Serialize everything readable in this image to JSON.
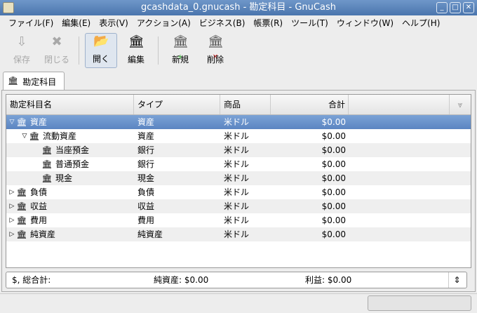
{
  "window": {
    "title": "gcashdata_0.gnucash - 勘定科目 - GnuCash"
  },
  "menu": [
    "ファイル(F)",
    "編集(E)",
    "表示(V)",
    "アクション(A)",
    "ビジネス(B)",
    "帳票(R)",
    "ツール(T)",
    "ウィンドウ(W)",
    "ヘルプ(H)"
  ],
  "toolbar": {
    "save": "保存",
    "close": "閉じる",
    "open": "開く",
    "edit": "編集",
    "new": "新規",
    "delete": "削除"
  },
  "tab": {
    "label": "勘定科目"
  },
  "columns": {
    "name": "勘定科目名",
    "type": "タイプ",
    "commodity": "商品",
    "total": "合計"
  },
  "accounts": [
    {
      "name": "資産",
      "type": "資産",
      "commodity": "米ドル",
      "total": "$0.00",
      "level": 0,
      "expander": "expanded",
      "selected": true
    },
    {
      "name": "流動資産",
      "type": "資産",
      "commodity": "米ドル",
      "total": "$0.00",
      "level": 1,
      "expander": "expanded"
    },
    {
      "name": "当座預金",
      "type": "銀行",
      "commodity": "米ドル",
      "total": "$0.00",
      "level": 2,
      "expander": "none"
    },
    {
      "name": "普通預金",
      "type": "銀行",
      "commodity": "米ドル",
      "total": "$0.00",
      "level": 2,
      "expander": "none"
    },
    {
      "name": "現金",
      "type": "現金",
      "commodity": "米ドル",
      "total": "$0.00",
      "level": 2,
      "expander": "none"
    },
    {
      "name": "負債",
      "type": "負債",
      "commodity": "米ドル",
      "total": "$0.00",
      "level": 0,
      "expander": "collapsed"
    },
    {
      "name": "収益",
      "type": "収益",
      "commodity": "米ドル",
      "total": "$0.00",
      "level": 0,
      "expander": "collapsed"
    },
    {
      "name": "費用",
      "type": "費用",
      "commodity": "米ドル",
      "total": "$0.00",
      "level": 0,
      "expander": "collapsed"
    },
    {
      "name": "純資産",
      "type": "純資産",
      "commodity": "米ドル",
      "total": "$0.00",
      "level": 0,
      "expander": "collapsed"
    }
  ],
  "summary": {
    "label": "$, 総合計:",
    "net_assets": "純資産: $0.00",
    "profit": "利益: $0.00"
  }
}
